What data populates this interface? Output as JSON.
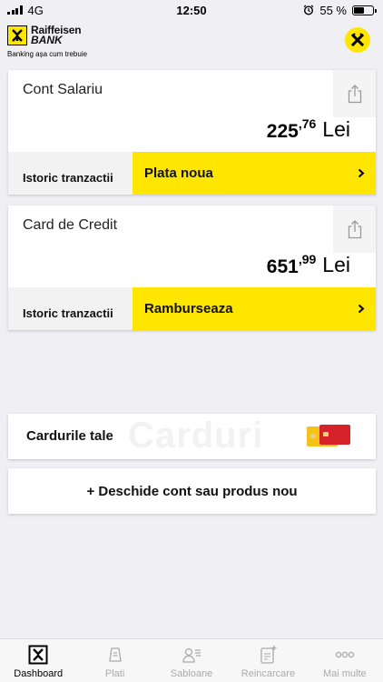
{
  "status_bar": {
    "carrier": "4G",
    "time": "12:50",
    "battery": "55 %",
    "battery_level": 0.55
  },
  "header": {
    "brand_name": "Raiffeisen",
    "brand_bank": "BANK",
    "tagline": "Banking așa cum trebuie",
    "icon": "raiffeisen-cross-icon"
  },
  "accounts": [
    {
      "name": "Cont Salariu",
      "balance_int": "225",
      "balance_dec": ",76",
      "currency": "Lei",
      "history_label": "Istoric tranzactii",
      "action_label": "Plata noua"
    },
    {
      "name": "Card de Credit",
      "balance_int": "651",
      "balance_dec": ",99",
      "currency": "Lei",
      "history_label": "Istoric tranzactii",
      "action_label": "Ramburseaza"
    }
  ],
  "cards_promo": {
    "label": "Cardurile tale",
    "watermark": "Carduri"
  },
  "open_product": {
    "label": "+ Deschide cont sau produs nou"
  },
  "tabs": [
    {
      "label": "Dashboard",
      "icon": "raiffeisen-logo-icon",
      "active": true
    },
    {
      "label": "Plati",
      "icon": "payment-icon",
      "active": false
    },
    {
      "label": "Sabloane",
      "icon": "templates-icon",
      "active": false
    },
    {
      "label": "Reincarcare",
      "icon": "top-up-icon",
      "active": false
    },
    {
      "label": "Mai multe",
      "icon": "more-icon",
      "active": false
    }
  ],
  "colors": {
    "brand_yellow": "#fee600",
    "background": "#efeff4"
  }
}
